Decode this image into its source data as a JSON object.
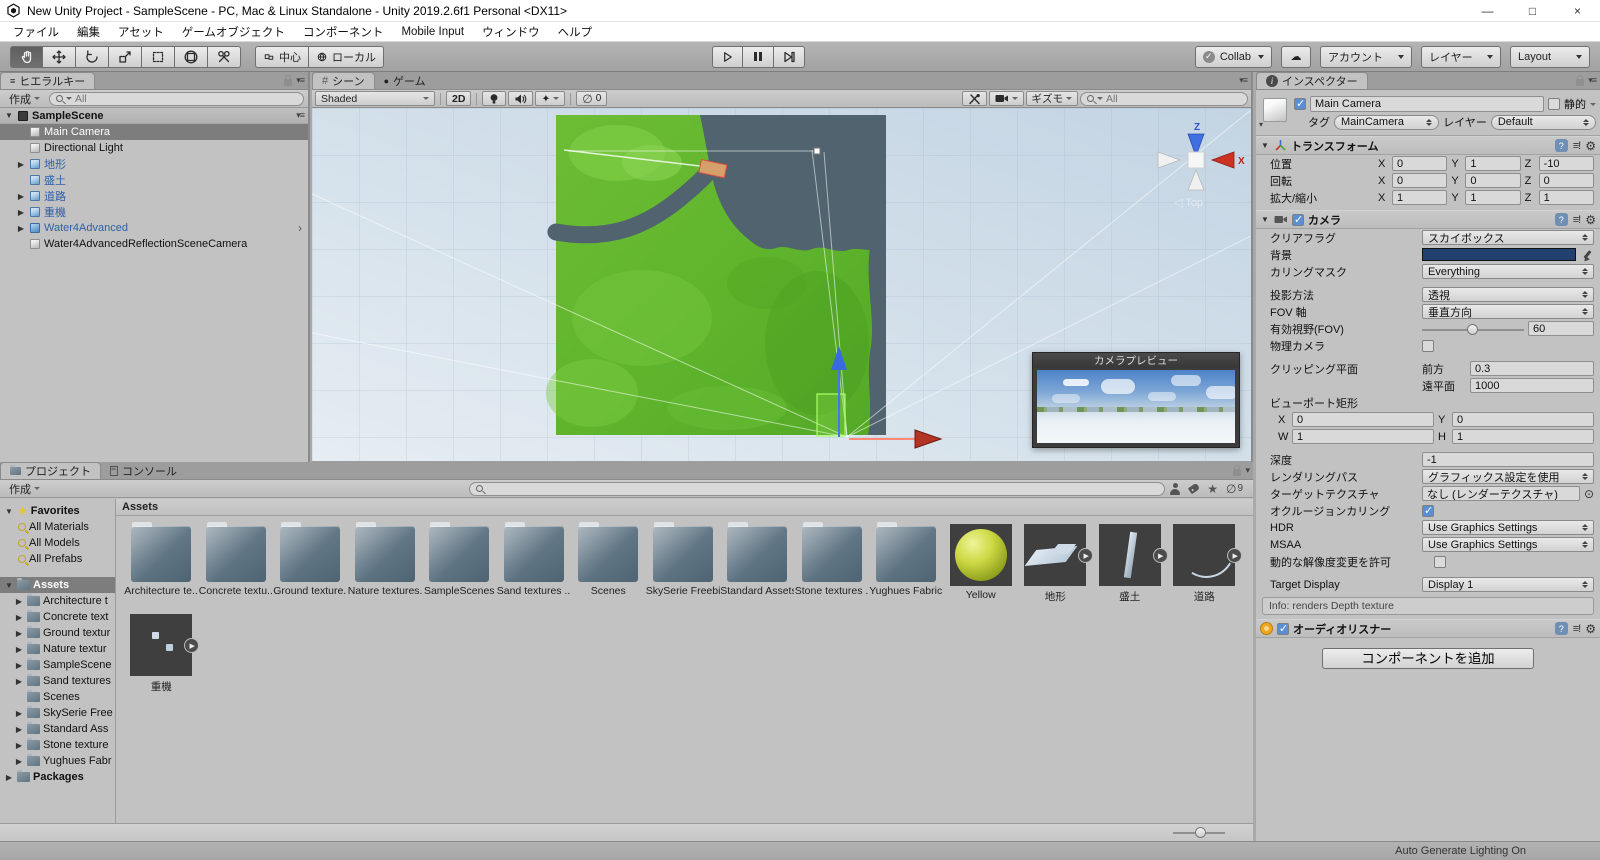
{
  "window": {
    "title": "New Unity Project - SampleScene - PC, Mac & Linux Standalone - Unity 2019.2.6f1 Personal <DX11>",
    "minimize": "—",
    "maximize": "□",
    "close": "×",
    "menus": [
      "ファイル",
      "編集",
      "アセット",
      "ゲームオブジェクト",
      "コンポーネント",
      "Mobile Input",
      "ウィンドウ",
      "ヘルプ"
    ]
  },
  "toolbar": {
    "pivot_center": "中心",
    "pivot_local": "ローカル",
    "collab": "Collab",
    "account": "アカウント",
    "layers": "レイヤー",
    "layout": "Layout"
  },
  "hierarchy": {
    "tab": "ヒエラルキー",
    "create": "作成",
    "search_placeholder": "All",
    "scene": "SampleScene",
    "items": [
      {
        "label": "Main Camera",
        "cls": "row-selected",
        "icon": "cube-gray",
        "expander": ""
      },
      {
        "label": "Directional Light",
        "cls": "",
        "icon": "cube-gray",
        "expander": ""
      },
      {
        "label": "地形",
        "cls": "prefab",
        "icon": "cube-blue",
        "expander": "▶"
      },
      {
        "label": "盛土",
        "cls": "prefab",
        "icon": "cube-blue",
        "expander": ""
      },
      {
        "label": "道路",
        "cls": "prefab",
        "icon": "cube-blue",
        "expander": "▶"
      },
      {
        "label": "重機",
        "cls": "prefab",
        "icon": "cube-blue",
        "expander": "▶"
      },
      {
        "label": "Water4Advanced",
        "cls": "prefab",
        "icon": "cube-water",
        "expander": "▶",
        "chevron": "›"
      },
      {
        "label": "Water4AdvancedReflectionSceneCamera",
        "cls": "",
        "icon": "cube-gray",
        "expander": ""
      }
    ]
  },
  "scene": {
    "tab_scene": "シーン",
    "tab_game": "ゲーム",
    "draw_mode": "Shaded",
    "btn_2d": "2D",
    "hidden_count": "0",
    "gizmos": "ギズモ",
    "search_placeholder": "All",
    "view_label": "Top",
    "axis_z": "Z",
    "axis_x": "X",
    "camera_preview_title": "カメラプレビュー"
  },
  "inspector": {
    "tab": "インスペクター",
    "name": "Main Camera",
    "static_label": "静的",
    "tag_label": "タグ",
    "tag": "MainCamera",
    "layer_label": "レイヤー",
    "layer": "Default",
    "transform": {
      "title": "トランスフォーム",
      "rows": [
        {
          "label": "位置",
          "x": "0",
          "y": "1",
          "z": "-10"
        },
        {
          "label": "回転",
          "x": "0",
          "y": "0",
          "z": "0"
        },
        {
          "label": "拡大/縮小",
          "x": "1",
          "y": "1",
          "z": "1"
        }
      ]
    },
    "camera": {
      "title": "カメラ",
      "clear_flags_label": "クリアフラグ",
      "clear_flags": "スカイボックス",
      "background_label": "背景",
      "culling_label": "カリングマスク",
      "culling": "Everything",
      "projection_label": "投影方法",
      "projection": "透視",
      "fov_axis_label": "FOV 軸",
      "fov_axis": "垂直方向",
      "fov_label": "有効視野(FOV)",
      "fov": "60",
      "physical_label": "物理カメラ",
      "clipping_label": "クリッピング平面",
      "near_label": "前方",
      "near": "0.3",
      "far_label": "遠平面",
      "far": "1000",
      "viewport_label": "ビューポート矩形",
      "vx_label": "X",
      "vx": "0",
      "vy_label": "Y",
      "vy": "0",
      "vw_label": "W",
      "vw": "1",
      "vh_label": "H",
      "vh": "1",
      "depth_label": "深度",
      "depth": "-1",
      "rendering_label": "レンダリングパス",
      "rendering": "グラフィックス設定を使用",
      "target_tex_label": "ターゲットテクスチャ",
      "target_tex": "なし (レンダーテクスチャ)",
      "occlusion_label": "オクルージョンカリング",
      "hdr_label": "HDR",
      "hdr": "Use Graphics Settings",
      "msaa_label": "MSAA",
      "msaa": "Use Graphics Settings",
      "dynamic_label": "動的な解像度変更を許可",
      "target_display_label": "Target Display",
      "target_display": "Display 1",
      "info": "Info: renders Depth texture"
    },
    "audio": {
      "title": "オーディオリスナー"
    },
    "add_component": "コンポーネントを追加"
  },
  "project": {
    "tab_project": "プロジェクト",
    "tab_console": "コンソール",
    "create": "作成",
    "search_placeholder": "",
    "hidden_count": "9",
    "favorites_label": "Favorites",
    "favorites": [
      "All Materials",
      "All Models",
      "All Prefabs"
    ],
    "assets_label": "Assets",
    "tree": [
      {
        "label": "Architecture t",
        "expander": "▶"
      },
      {
        "label": "Concrete text",
        "expander": "▶"
      },
      {
        "label": "Ground textur",
        "expander": "▶"
      },
      {
        "label": "Nature textur",
        "expander": "▶"
      },
      {
        "label": "SampleScene",
        "expander": "▶"
      },
      {
        "label": "Sand textures",
        "expander": "▶"
      },
      {
        "label": "Scenes",
        "expander": ""
      },
      {
        "label": "SkySerie Free",
        "expander": "▶"
      },
      {
        "label": "Standard Ass",
        "expander": "▶"
      },
      {
        "label": "Stone texture",
        "expander": "▶"
      },
      {
        "label": "Yughues Fabr",
        "expander": "▶"
      }
    ],
    "packages_label": "Packages",
    "breadcrumb": "Assets",
    "grid": [
      {
        "label": "Architecture te...",
        "thumb": "folder"
      },
      {
        "label": "Concrete textu...",
        "thumb": "folder"
      },
      {
        "label": "Ground texture...",
        "thumb": "folder"
      },
      {
        "label": "Nature textures...",
        "thumb": "folder"
      },
      {
        "label": "SampleScenes",
        "thumb": "folder"
      },
      {
        "label": "Sand textures ...",
        "thumb": "folder"
      },
      {
        "label": "Scenes",
        "thumb": "folder"
      },
      {
        "label": "SkySerie Freebie",
        "thumb": "folder"
      },
      {
        "label": "Standard Assets",
        "thumb": "folder"
      },
      {
        "label": "Stone textures ...",
        "thumb": "folder"
      },
      {
        "label": "Yughues Fabric...",
        "thumb": "folder"
      },
      {
        "label": "Yellow",
        "thumb": "sphere"
      },
      {
        "label": "地形",
        "thumb": "plane",
        "badge": "▶"
      },
      {
        "label": "盛土",
        "thumb": "slab",
        "badge": "▶"
      },
      {
        "label": "道路",
        "thumb": "curve",
        "badge": "▶"
      },
      {
        "label": "重機",
        "thumb": "machine",
        "badge": "▶"
      }
    ]
  },
  "status": {
    "right": "Auto Generate Lighting On"
  },
  "colors": {
    "prefab_text": "#3060a8",
    "camera_background_swatch": "#22406e",
    "terrain_green": "#61b52e",
    "water_slate": "#50636f",
    "viewport_blue": "#cfdde9"
  }
}
